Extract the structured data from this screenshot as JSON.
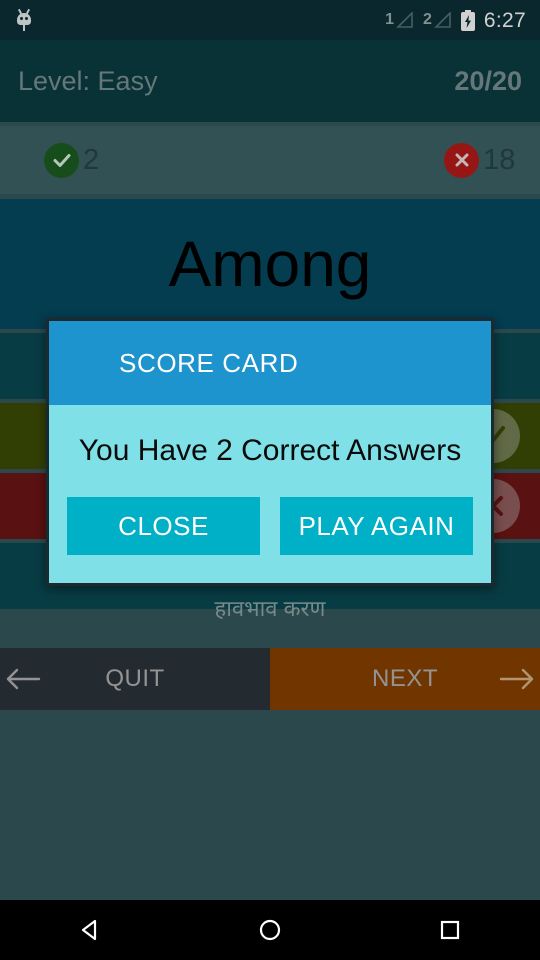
{
  "status_bar": {
    "android_icon": "android-robot-icon",
    "sim1_label": "1",
    "sim2_label": "2",
    "battery_icon": "battery-charging-icon",
    "time": "6:27"
  },
  "header": {
    "level_label": "Level: Easy",
    "progress": "20/20"
  },
  "score_strip": {
    "correct_icon": "check-circle-icon",
    "correct_count": "2",
    "wrong_icon": "x-circle-icon",
    "wrong_count": "18"
  },
  "quiz": {
    "question": "Among",
    "options": [
      {
        "text": "",
        "state": "neutral",
        "mark": ""
      },
      {
        "text": "",
        "state": "correct",
        "mark": "check-icon"
      },
      {
        "text": "",
        "state": "wrong",
        "mark": "x-icon"
      },
      {
        "text": "",
        "state": "neutral",
        "mark": ""
      }
    ],
    "answer_text": "हावभाव करण"
  },
  "footer": {
    "quit_label": "QUIT",
    "quit_icon": "arrow-left-icon",
    "next_label": "NEXT",
    "next_icon": "arrow-right-icon"
  },
  "dialog": {
    "title": "SCORE CARD",
    "message": "You Have 2 Correct Answers",
    "close_label": "CLOSE",
    "play_again_label": "PLAY AGAIN"
  },
  "system_nav": {
    "back_icon": "back-triangle-icon",
    "home_icon": "home-circle-icon",
    "recents_icon": "recents-square-icon"
  },
  "colors": {
    "status_bar": "#0b3036",
    "header": "#0b3d43",
    "score_strip": "#3d6367",
    "question_box": "#064a62",
    "option_neutral": "#0a4a53",
    "option_correct": "#3d4d05",
    "option_wrong": "#6e1515",
    "dialog_title": "#1e94ce",
    "dialog_body": "#7fe0e8",
    "dialog_button": "#00b0c7",
    "quit_button": "#2b353c",
    "next_button": "#8a4300",
    "page_background": "#35595e"
  }
}
